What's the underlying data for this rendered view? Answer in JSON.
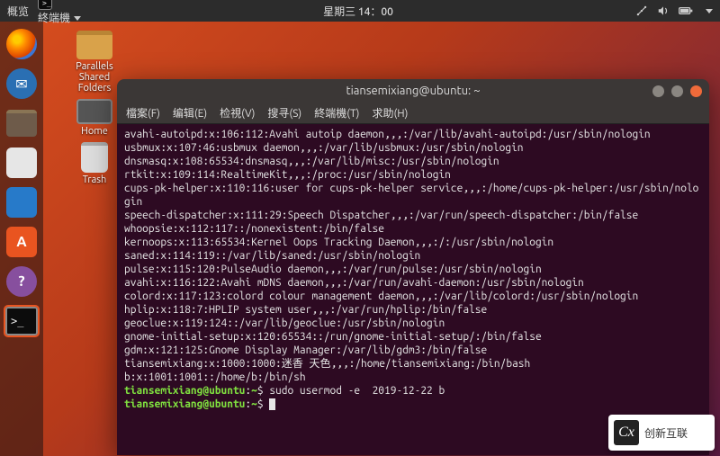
{
  "topbar": {
    "overview": "概览",
    "app_indicator": "終端機",
    "clock": "星期三 14：00",
    "icons": [
      "network-icon",
      "volume-icon",
      "battery-icon",
      "power-icon"
    ]
  },
  "desktop": {
    "items": [
      {
        "label": "Parallels\nShared\nFolders"
      },
      {
        "label": "Home"
      },
      {
        "label": "Trash"
      }
    ]
  },
  "dock": {
    "items": [
      "firefox",
      "thunderbird",
      "files",
      "rhythmbox",
      "writer",
      "software",
      "help",
      "terminal"
    ]
  },
  "terminal": {
    "title": "tiansemixiang@ubuntu: ~",
    "menu": [
      "檔案(F)",
      "编辑(E)",
      "检視(V)",
      "搜寻(S)",
      "終端機(T)",
      "求助(H)"
    ],
    "lines": [
      "avahi-autoipd:x:106:112:Avahi autoip daemon,,,:/var/lib/avahi-autoipd:/usr/sbin/nologin",
      "usbmux:x:107:46:usbmux daemon,,,:/var/lib/usbmux:/usr/sbin/nologin",
      "dnsmasq:x:108:65534:dnsmasq,,,:/var/lib/misc:/usr/sbin/nologin",
      "rtkit:x:109:114:RealtimeKit,,,:/proc:/usr/sbin/nologin",
      "cups-pk-helper:x:110:116:user for cups-pk-helper service,,,:/home/cups-pk-helper:/usr/sbin/nologin",
      "speech-dispatcher:x:111:29:Speech Dispatcher,,,:/var/run/speech-dispatcher:/bin/false",
      "whoopsie:x:112:117::/nonexistent:/bin/false",
      "kernoops:x:113:65534:Kernel Oops Tracking Daemon,,,:/:/usr/sbin/nologin",
      "saned:x:114:119::/var/lib/saned:/usr/sbin/nologin",
      "pulse:x:115:120:PulseAudio daemon,,,:/var/run/pulse:/usr/sbin/nologin",
      "avahi:x:116:122:Avahi mDNS daemon,,,:/var/run/avahi-daemon:/usr/sbin/nologin",
      "colord:x:117:123:colord colour management daemon,,,:/var/lib/colord:/usr/sbin/nologin",
      "hplip:x:118:7:HPLIP system user,,,:/var/run/hplip:/bin/false",
      "geoclue:x:119:124::/var/lib/geoclue:/usr/sbin/nologin",
      "gnome-initial-setup:x:120:65534::/run/gnome-initial-setup/:/bin/false",
      "gdm:x:121:125:Gnome Display Manager:/var/lib/gdm3:/bin/false",
      "tiansemixiang:x:1000:1000:迷香 天色,,,:/home/tiansemixiang:/bin/bash",
      "b:x:1001:1001::/home/b:/bin/sh"
    ],
    "prompt_user": "tiansemixiang@ubuntu",
    "prompt_path": "~",
    "prompt_suffix": "$",
    "command_1": "sudo usermod -e  2019-12-22 b",
    "command_2": ""
  },
  "watermark": {
    "logo": "Cx",
    "text": "创新互联"
  }
}
